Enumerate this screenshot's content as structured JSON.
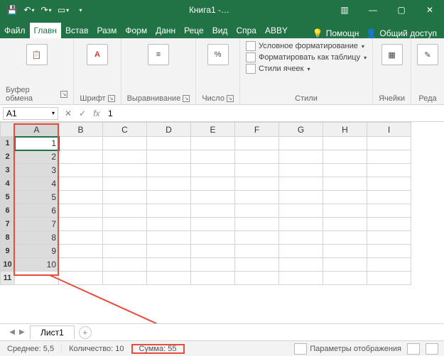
{
  "title": "Книга1 -…",
  "tabs": {
    "file": "Файл",
    "home": "Главн",
    "insert": "Встав",
    "layout": "Разм",
    "formulas": "Форм",
    "data": "Данн",
    "review": "Реце",
    "view": "Вид",
    "help": "Спра",
    "abby": "ABBY",
    "tell": "Помощн",
    "share": "Общий доступ"
  },
  "ribbon": {
    "clipboard": "Буфер обмена",
    "font": "Шрифт",
    "alignment": "Выравнивание",
    "number": "Число",
    "styles_label": "Стили",
    "cond_fmt": "Условное форматирование",
    "fmt_table": "Форматировать как таблицу",
    "cell_styles": "Стили ячеек",
    "cells": "Ячейки",
    "editing": "Реда"
  },
  "namebox": "A1",
  "fx_value": "1",
  "columns": [
    "A",
    "B",
    "C",
    "D",
    "E",
    "F",
    "G",
    "H",
    "I"
  ],
  "rows": [
    1,
    2,
    3,
    4,
    5,
    6,
    7,
    8,
    9,
    10,
    11
  ],
  "colA_values": [
    "1",
    "2",
    "3",
    "4",
    "5",
    "6",
    "7",
    "8",
    "9",
    "10",
    ""
  ],
  "sheet_tab": "Лист1",
  "status": {
    "avg_label": "Среднее:",
    "avg_value": "5,5",
    "count_label": "Количество:",
    "count_value": "10",
    "sum_label": "Сумма:",
    "sum_value": "55",
    "display_opts": "Параметры отображения"
  },
  "chart_data": {
    "type": "table",
    "title": "Spreadsheet column A (selected range A1:A10)",
    "columns": [
      "A"
    ],
    "values": [
      1,
      2,
      3,
      4,
      5,
      6,
      7,
      8,
      9,
      10
    ],
    "aggregates": {
      "sum": 55,
      "count": 10,
      "average": 5.5
    }
  }
}
